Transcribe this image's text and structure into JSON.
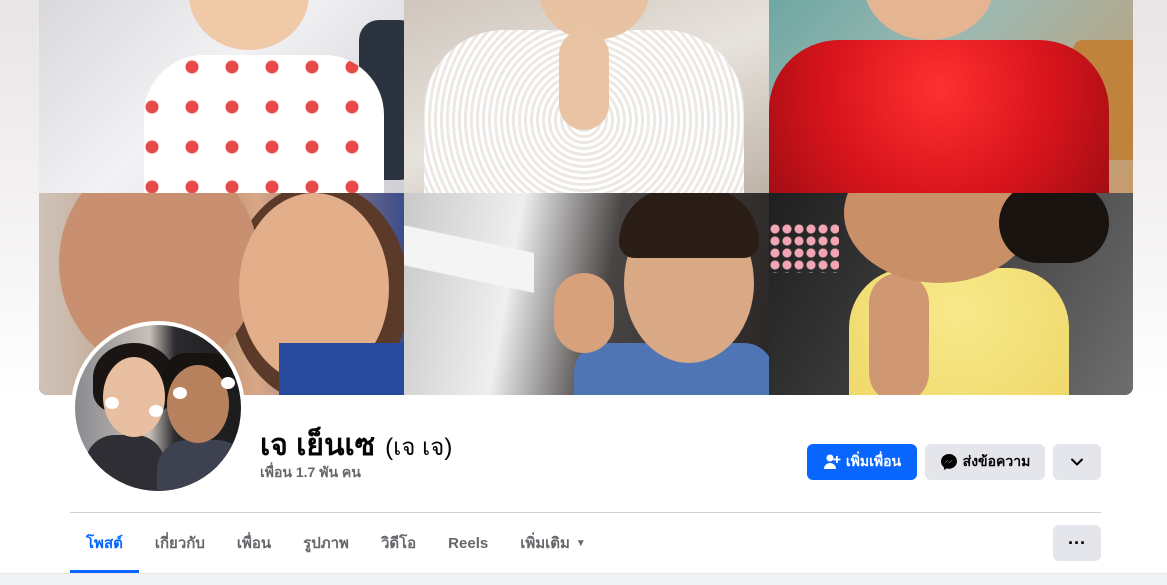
{
  "profile": {
    "name": "เจ เย็นเซ",
    "alt_name": "(เจ เจ)",
    "friends_count": "เพื่อน 1.7 พัน คน"
  },
  "actions": {
    "add_friend_label": "เพิ่มเพื่อน",
    "message_label": "ส่งข้อความ",
    "more_icon": "chevron-down-icon"
  },
  "tabs": [
    {
      "label": "โพสต์",
      "active": true
    },
    {
      "label": "เกี่ยวกับ",
      "active": false
    },
    {
      "label": "เพื่อน",
      "active": false
    },
    {
      "label": "รูปภาพ",
      "active": false
    },
    {
      "label": "วิดีโอ",
      "active": false
    },
    {
      "label": "Reels",
      "active": false
    },
    {
      "label": "เพิ่มเติม",
      "active": false,
      "has_dropdown": true
    }
  ],
  "tabs_more_label": "···",
  "colors": {
    "accent": "#0866ff",
    "secondary_button": "#e4e6eb",
    "muted_text": "#65676b"
  }
}
